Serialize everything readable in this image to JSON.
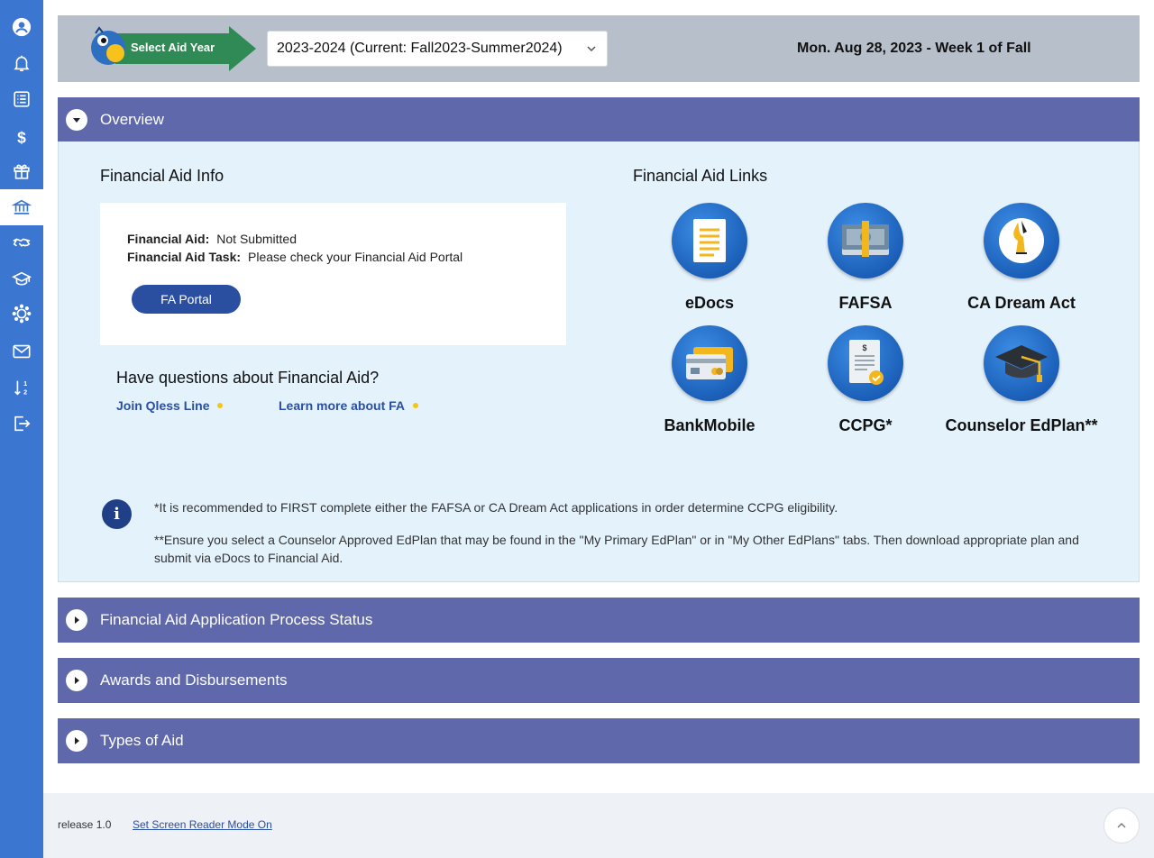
{
  "sidebar": {
    "items": [
      {
        "icon": "profile-icon"
      },
      {
        "icon": "bell-icon"
      },
      {
        "icon": "list-icon"
      },
      {
        "icon": "dollar-icon"
      },
      {
        "icon": "gift-icon"
      },
      {
        "icon": "bank-icon",
        "active": true
      },
      {
        "icon": "handshake-icon"
      },
      {
        "icon": "graduation-cap-icon"
      },
      {
        "icon": "canvas-icon"
      },
      {
        "icon": "mail-icon"
      },
      {
        "icon": "sort-icon"
      },
      {
        "icon": "logout-icon"
      }
    ]
  },
  "header": {
    "aid_year_logo_text": "Select Aid Year",
    "aid_year_selected": "2023-2024 (Current: Fall2023-Summer2024)",
    "date_text": "Mon. Aug 28, 2023 - Week 1 of Fall"
  },
  "overview": {
    "title": "Overview",
    "fa_info_title": "Financial Aid Info",
    "fa_label": "Financial Aid:",
    "fa_value": "Not Submitted",
    "fa_task_label": "Financial Aid Task:",
    "fa_task_value": "Please check your Financial Aid Portal",
    "fa_portal_button": "FA Portal",
    "questions_title": "Have questions about Financial Aid?",
    "join_qless": "Join Qless Line",
    "learn_more": "Learn more about FA",
    "links_title": "Financial Aid Links",
    "links": [
      {
        "label": "eDocs"
      },
      {
        "label": "FAFSA"
      },
      {
        "label": "CA Dream Act"
      },
      {
        "label": "BankMobile"
      },
      {
        "label": "CCPG*"
      },
      {
        "label": "Counselor EdPlan**"
      }
    ],
    "note1": "*It is recommended to FIRST complete either the FAFSA or CA Dream Act applications in order determine CCPG eligibility.",
    "note2": "**Ensure you select a Counselor Approved EdPlan that may be found in the \"My Primary EdPlan\" or in \"My Other EdPlans\" tabs. Then download appropriate plan and submit via eDocs to Financial Aid.",
    "info_glyph": "i"
  },
  "sections": [
    {
      "title": "Financial Aid Application Process Status"
    },
    {
      "title": "Awards and Disbursements"
    },
    {
      "title": "Types of Aid"
    }
  ],
  "footer": {
    "release": "release 1.0",
    "screen_reader_link": "Set Screen Reader Mode On"
  },
  "colors": {
    "sidebar": "#3b76d1",
    "panel_header": "#5f68ab",
    "panel_body": "#e4f2fc",
    "link": "#2a4fa0",
    "accent_dot": "#f5c518"
  }
}
